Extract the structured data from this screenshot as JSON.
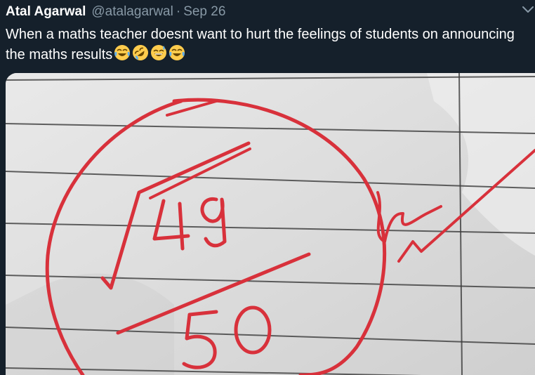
{
  "tweet": {
    "author_name": "Atal Agarwal",
    "author_handle": "@atalagarwal",
    "separator": "·",
    "timestamp": "Sep 26",
    "text": "When a maths teacher doesnt want to hurt the feelings of students on announcing the maths results",
    "emojis": [
      "face-with-tears-of-joy",
      "rolling-on-the-floor-laughing",
      "grinning-face-with-sweat",
      "face-with-tears-of-joy"
    ]
  },
  "media": {
    "handwritten_marks": {
      "numerator": "√49",
      "denominator": "50",
      "ink_color": "#d8313b"
    }
  },
  "colors": {
    "background": "#15202b",
    "secondary_text": "#8899a6",
    "primary_text": "#ffffff"
  }
}
